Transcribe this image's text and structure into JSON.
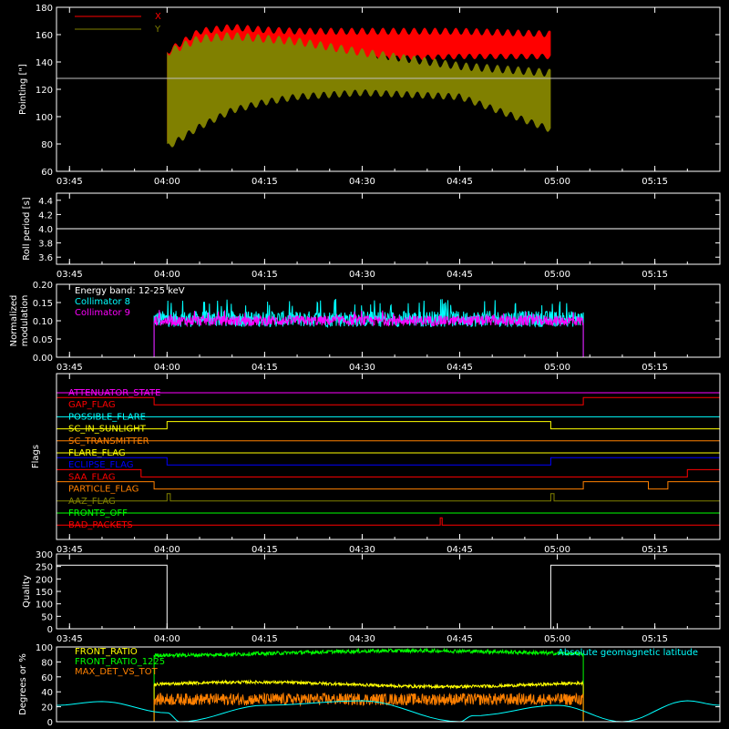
{
  "chart_data": [
    {
      "type": "line",
      "id": "pointing",
      "ylabel": "Pointing [\"]",
      "ylim": [
        60,
        180
      ],
      "yticks": [
        60,
        80,
        100,
        120,
        140,
        160,
        180
      ],
      "xlim": [
        "03:43",
        "05:25"
      ],
      "xticks": [
        "03:45",
        "04:00",
        "04:15",
        "04:30",
        "04:45",
        "05:00",
        "05:15"
      ],
      "reference_line": 128,
      "legend_placement": "top-left",
      "series": [
        {
          "name": "X",
          "color": "#ff0000",
          "start": "04:00",
          "end": "04:59",
          "envelope": [
            [
              "04:00",
              150,
              78
            ],
            [
              "04:05",
              165,
              110
            ],
            [
              "04:10",
              168,
              125
            ],
            [
              "04:15",
              166,
              133
            ],
            [
              "04:20",
              165,
              138
            ],
            [
              "04:30",
              165,
              140
            ],
            [
              "04:45",
              165,
              142
            ],
            [
              "04:59",
              163,
              142
            ]
          ]
        },
        {
          "name": "Y",
          "color": "#808000",
          "start": "04:00",
          "end": "04:59",
          "envelope": [
            [
              "04:00",
              150,
              75
            ],
            [
              "04:05",
              160,
              90
            ],
            [
              "04:10",
              162,
              102
            ],
            [
              "04:15",
              160,
              108
            ],
            [
              "04:20",
              158,
              112
            ],
            [
              "04:30",
              150,
              115
            ],
            [
              "04:45",
              140,
              112
            ],
            [
              "04:59",
              135,
              88
            ]
          ]
        }
      ]
    },
    {
      "type": "line",
      "id": "roll",
      "ylabel": "Roll period [s]",
      "ylim": [
        3.5,
        4.5
      ],
      "yticks": [
        3.6,
        3.8,
        4.0,
        4.2,
        4.4
      ],
      "xticks": [
        "03:45",
        "04:00",
        "04:15",
        "04:30",
        "04:45",
        "05:00",
        "05:15"
      ],
      "series": [
        {
          "name": "",
          "color": "#ffffff",
          "constant": 4.0
        }
      ]
    },
    {
      "type": "line",
      "id": "modulation",
      "ylabel_line1": "Normalized",
      "ylabel_line2": "modulation",
      "ylim": [
        0.0,
        0.2
      ],
      "yticks": [
        "0.00",
        "0.05",
        "0.10",
        "0.15",
        "0.20"
      ],
      "xticks": [
        "03:45",
        "04:00",
        "04:15",
        "04:30",
        "04:45",
        "05:00",
        "05:15"
      ],
      "annotation": "Energy band: 12-25 keV",
      "series": [
        {
          "name": "Collimator 8",
          "color": "#00ffff",
          "start": "03:58",
          "end": "05:04",
          "mean": 0.105,
          "min": 0.08,
          "max": 0.16
        },
        {
          "name": "Collimator 9",
          "color": "#ff00ff",
          "start": "03:58",
          "end": "05:04",
          "mean": 0.1,
          "min": 0.08,
          "max": 0.13
        }
      ]
    },
    {
      "type": "line",
      "id": "flags",
      "ylabel": "Flags",
      "xticks": [
        "03:45",
        "04:00",
        "04:15",
        "04:30",
        "04:45",
        "05:00",
        "05:15"
      ],
      "series": [
        {
          "name": "ATTENUATOR_STATE",
          "color": "#ff00ff",
          "steps": [
            [
              "03:43",
              0
            ],
            [
              "05:25",
              0
            ]
          ]
        },
        {
          "name": "GAP_FLAG",
          "color": "#ff0000",
          "steps": [
            [
              "03:43",
              1
            ],
            [
              "03:58",
              0
            ],
            [
              "05:04",
              1
            ]
          ]
        },
        {
          "name": "POSSIBLE_FLARE",
          "color": "#00ffff",
          "steps": [
            [
              "03:43",
              0
            ]
          ]
        },
        {
          "name": "SC_IN_SUNLIGHT",
          "color": "#ffff00",
          "steps": [
            [
              "03:43",
              0
            ],
            [
              "04:00",
              1
            ],
            [
              "04:59",
              0
            ]
          ]
        },
        {
          "name": "SC_TRANSMITTER",
          "color": "#ff8000",
          "steps": [
            [
              "03:43",
              0
            ]
          ]
        },
        {
          "name": "FLARE_FLAG",
          "color": "#ffff00",
          "steps": [
            [
              "03:43",
              0
            ]
          ]
        },
        {
          "name": "ECLIPSE_FLAG",
          "color": "#0000ff",
          "steps": [
            [
              "03:43",
              1
            ],
            [
              "04:00",
              0
            ],
            [
              "04:59",
              1
            ]
          ]
        },
        {
          "name": "SAA_FLAG",
          "color": "#ff0000",
          "steps": [
            [
              "03:43",
              1
            ],
            [
              "03:56",
              0
            ],
            [
              "05:20",
              1
            ]
          ]
        },
        {
          "name": "PARTICLE_FLAG",
          "color": "#ff8000",
          "steps": [
            [
              "03:43",
              1
            ],
            [
              "03:58",
              0
            ],
            [
              "05:04",
              1
            ],
            [
              "05:14",
              0
            ],
            [
              "05:17",
              1
            ]
          ]
        },
        {
          "name": "AAZ_FLAG",
          "color": "#808000",
          "steps": [
            [
              "03:43",
              0
            ],
            [
              "04:00",
              1
            ],
            [
              "04:00.5",
              0
            ],
            [
              "04:59",
              1
            ],
            [
              "04:59.5",
              0
            ]
          ]
        },
        {
          "name": "FRONTS_OFF",
          "color": "#00ff00",
          "steps": [
            [
              "03:43",
              0
            ]
          ]
        },
        {
          "name": "BAD_PACKETS",
          "color": "#ff0000",
          "steps": [
            [
              "03:43",
              0
            ],
            [
              "04:42",
              1
            ],
            [
              "04:42.3",
              0
            ]
          ]
        }
      ]
    },
    {
      "type": "line",
      "id": "quality",
      "ylabel": "Quality",
      "ylim": [
        0,
        300
      ],
      "yticks": [
        0,
        50,
        100,
        150,
        200,
        250,
        300
      ],
      "xticks": [
        "03:45",
        "04:00",
        "04:15",
        "04:30",
        "04:45",
        "05:00",
        "05:15"
      ],
      "series": [
        {
          "name": "",
          "color": "#ffffff",
          "steps": [
            [
              "03:43",
              255
            ],
            [
              "04:00",
              0
            ],
            [
              "04:59",
              255
            ]
          ]
        }
      ]
    },
    {
      "type": "line",
      "id": "ratios",
      "ylabel": "Degrees or %",
      "ylim": [
        0,
        100
      ],
      "yticks": [
        0,
        20,
        40,
        60,
        80,
        100
      ],
      "series": [
        {
          "name": "FRONT_RATIO",
          "color": "#ffff00",
          "start": "03:58",
          "end": "05:04",
          "mean": 50
        },
        {
          "name": "FRONT_RATIO_1225",
          "color": "#00ff00",
          "start": "03:58",
          "end": "05:04",
          "mean": 92
        },
        {
          "name": "MAX_DET_VS_TOT",
          "color": "#ff8000",
          "start": "03:58",
          "end": "05:04",
          "mean": 30
        },
        {
          "name": "Absolute geomagnetic latitude",
          "color": "#00ffff",
          "curve": [
            [
              "03:43",
              22
            ],
            [
              "03:50",
              27
            ],
            [
              "04:00",
              12
            ],
            [
              "04:02",
              0
            ],
            [
              "04:15",
              22
            ],
            [
              "04:30",
              28
            ],
            [
              "04:45",
              0
            ],
            [
              "04:47",
              8
            ],
            [
              "05:00",
              22
            ],
            [
              "05:10",
              0
            ],
            [
              "05:20",
              28
            ],
            [
              "05:25",
              22
            ]
          ]
        }
      ]
    }
  ]
}
